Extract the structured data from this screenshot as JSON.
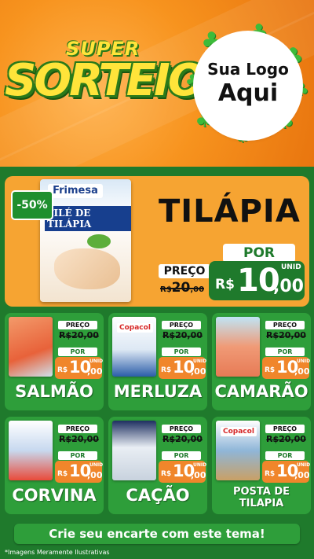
{
  "header": {
    "super_label": "SUPER",
    "sorteio_label": "SORTEIO",
    "brand_line1": "Sua Logo",
    "brand_line2": "Aqui"
  },
  "hero": {
    "discount_badge": "-50%",
    "product_brand": "Frimesa",
    "product_pack_title": "FILÉ DE TILÁPIA",
    "product_name": "TILÁPIA",
    "preco_label": "PREÇO",
    "old_price_prefix": "R$",
    "old_price_int": "20",
    "old_price_dec": ",00",
    "por_label": "POR",
    "currency": "R$",
    "price_int": "10",
    "price_dec": ",00",
    "unit": "UNID"
  },
  "cards": [
    {
      "name": "SALMÃO",
      "preco_label": "PREÇO",
      "old_price": "R$20,00",
      "por_label": "POR",
      "currency": "R$",
      "price_int": "10",
      "price_dec": ",00",
      "unit": "UNID"
    },
    {
      "name": "MERLUZA",
      "preco_label": "PREÇO",
      "old_price": "R$20,00",
      "por_label": "POR",
      "currency": "R$",
      "price_int": "10",
      "price_dec": ",00",
      "unit": "UNID",
      "pack_brand": "Copacol"
    },
    {
      "name": "CAMARÃO",
      "preco_label": "PREÇO",
      "old_price": "R$20,00",
      "por_label": "POR",
      "currency": "R$",
      "price_int": "10",
      "price_dec": ",00",
      "unit": "UNID"
    },
    {
      "name": "CORVINA",
      "preco_label": "PREÇO",
      "old_price": "R$20,00",
      "por_label": "POR",
      "currency": "R$",
      "price_int": "10",
      "price_dec": ",00",
      "unit": "UNID"
    },
    {
      "name": "CAÇÃO",
      "preco_label": "PREÇO",
      "old_price": "R$20,00",
      "por_label": "POR",
      "currency": "R$",
      "price_int": "10",
      "price_dec": ",00",
      "unit": "UNID"
    },
    {
      "name": "POSTA DE TILAPIA",
      "preco_label": "PREÇO",
      "old_price": "R$20,00",
      "por_label": "POR",
      "currency": "R$",
      "price_int": "10",
      "price_dec": ",00",
      "unit": "UNID",
      "pack_brand": "Copacol"
    }
  ],
  "footer": {
    "cta": "Crie seu encarte com este tema!",
    "disclaimer": "*Imagens Meramente Ilustrativas"
  },
  "colors": {
    "orange": "#f7931e",
    "green": "#1f7a2c",
    "card_green": "#2e9e3a",
    "price_orange": "#f0862b",
    "yellow": "#ffe43a"
  },
  "icons": [
    "clover-icon"
  ]
}
